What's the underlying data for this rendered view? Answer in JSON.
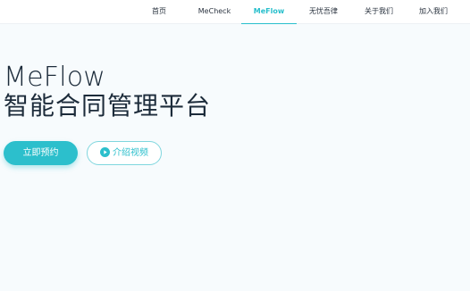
{
  "nav": {
    "items": [
      {
        "label": "首页"
      },
      {
        "label": "MeCheck"
      },
      {
        "label": "MeFlow"
      },
      {
        "label": "无忧吾律"
      },
      {
        "label": "关于我们"
      },
      {
        "label": "加入我们"
      }
    ],
    "active": "MeFlow"
  },
  "hero": {
    "title": "MeFlow",
    "subtitle": "智能合同管理平台",
    "primary_button": "立即预约",
    "secondary_button": "介绍视频",
    "secondary_icon": "play-circle-icon"
  },
  "colors": {
    "accent": "#2cbfcc",
    "background": "#f7fbfd",
    "text": "#1c2b3a"
  }
}
